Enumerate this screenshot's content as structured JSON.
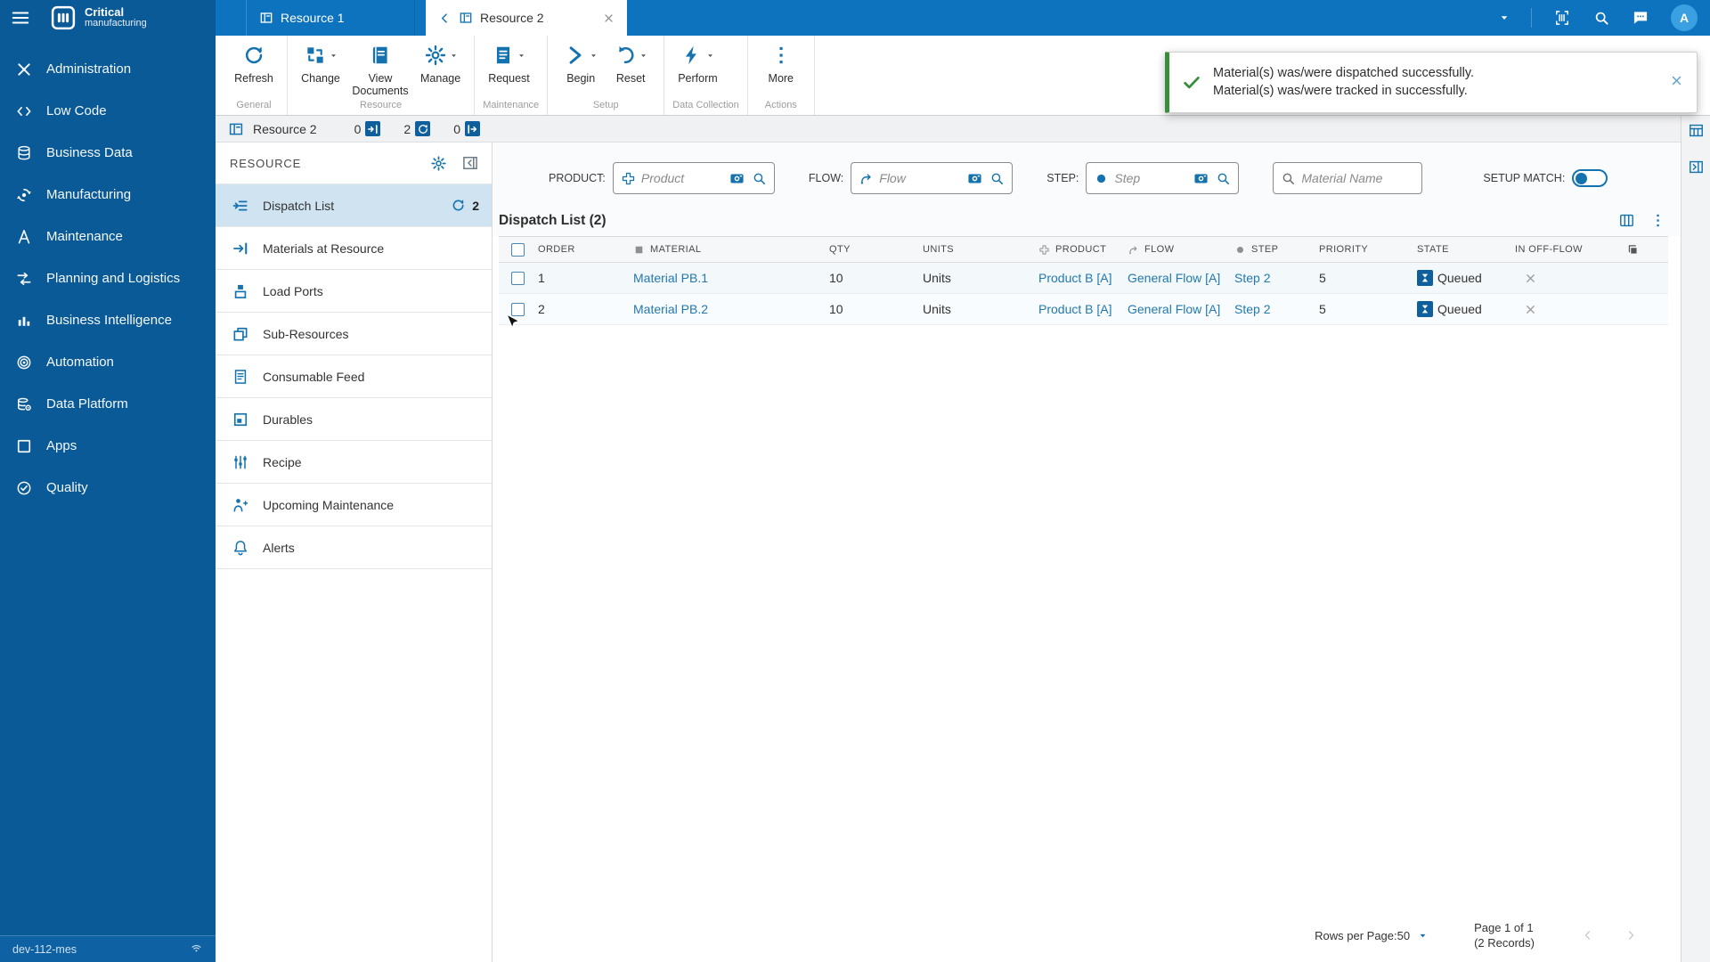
{
  "colors": {
    "sidebar": "#0a5a97",
    "topbar": "#0d73be",
    "accent": "#1473af",
    "link": "#2279ae",
    "toast_green": "#388e3c",
    "selected_item": "#cfe3f1"
  },
  "sidebar": {
    "brand": {
      "line1": "Critical",
      "line2": "manufacturing"
    },
    "items": [
      {
        "label": "Administration",
        "icon": "administration-icon"
      },
      {
        "label": "Low Code",
        "icon": "low-code-icon"
      },
      {
        "label": "Business Data",
        "icon": "business-data-icon"
      },
      {
        "label": "Manufacturing",
        "icon": "manufacturing-icon"
      },
      {
        "label": "Maintenance",
        "icon": "maintenance-icon"
      },
      {
        "label": "Planning and Logistics",
        "icon": "planning-logistics-icon"
      },
      {
        "label": "Business Intelligence",
        "icon": "business-intelligence-icon"
      },
      {
        "label": "Automation",
        "icon": "automation-icon"
      },
      {
        "label": "Data Platform",
        "icon": "data-platform-icon"
      },
      {
        "label": "Apps",
        "icon": "apps-icon"
      },
      {
        "label": "Quality",
        "icon": "quality-icon"
      }
    ],
    "footer": {
      "environment": "dev-112-mes"
    }
  },
  "header": {
    "tabs": [
      {
        "label": "Resource 1",
        "active": false
      },
      {
        "label": "Resource 2",
        "active": true
      }
    ],
    "avatar_initial": "A"
  },
  "toolbar": {
    "groups": [
      {
        "label": "General",
        "buttons": [
          {
            "label": "Refresh",
            "icon": "refresh-icon",
            "dropdown": false
          }
        ]
      },
      {
        "label": "Resource",
        "buttons": [
          {
            "label": "Change",
            "icon": "change-icon",
            "dropdown": true
          },
          {
            "label": "View Documents",
            "icon": "view-documents-icon",
            "dropdown": false
          },
          {
            "label": "Manage",
            "icon": "manage-icon",
            "dropdown": true
          }
        ]
      },
      {
        "label": "Maintenance",
        "buttons": [
          {
            "label": "Request",
            "icon": "request-icon",
            "dropdown": true
          }
        ]
      },
      {
        "label": "Setup",
        "buttons": [
          {
            "label": "Begin",
            "icon": "begin-icon",
            "dropdown": true
          },
          {
            "label": "Reset",
            "icon": "reset-icon",
            "dropdown": true
          }
        ]
      },
      {
        "label": "Data Collection",
        "buttons": [
          {
            "label": "Perform",
            "icon": "perform-icon",
            "dropdown": true
          }
        ]
      },
      {
        "label": "Actions",
        "buttons": [
          {
            "label": "More",
            "icon": "more-icon",
            "dropdown": false
          }
        ]
      }
    ]
  },
  "breadcrumb": {
    "title": "Resource 2",
    "counters": [
      {
        "value": "0",
        "icon": "track-in-icon"
      },
      {
        "value": "2",
        "icon": "queue-count-icon"
      },
      {
        "value": "0",
        "icon": "track-out-icon"
      }
    ]
  },
  "resource_panel": {
    "title": "RESOURCE",
    "items": [
      {
        "label": "Dispatch List",
        "icon": "dispatch-list-icon",
        "selected": true,
        "badge": "2"
      },
      {
        "label": "Materials at Resource",
        "icon": "materials-at-resource-icon",
        "selected": false
      },
      {
        "label": "Load Ports",
        "icon": "load-ports-icon",
        "selected": false
      },
      {
        "label": "Sub-Resources",
        "icon": "sub-resources-icon",
        "selected": false
      },
      {
        "label": "Consumable Feed",
        "icon": "consumable-feed-icon",
        "selected": false
      },
      {
        "label": "Durables",
        "icon": "durables-icon",
        "selected": false
      },
      {
        "label": "Recipe",
        "icon": "recipe-icon",
        "selected": false
      },
      {
        "label": "Upcoming Maintenance",
        "icon": "upcoming-maintenance-icon",
        "selected": false
      },
      {
        "label": "Alerts",
        "icon": "alerts-icon",
        "selected": false
      }
    ]
  },
  "filters": {
    "product": {
      "label": "PRODUCT:",
      "placeholder": "Product"
    },
    "flow": {
      "label": "FLOW:",
      "placeholder": "Flow"
    },
    "step": {
      "label": "STEP:",
      "placeholder": "Step"
    },
    "material_name": {
      "placeholder": "Material Name"
    },
    "setup_match": {
      "label": "SETUP MATCH:",
      "enabled": false
    }
  },
  "dispatch": {
    "title": "Dispatch List (2)",
    "columns": [
      {
        "key": "select",
        "label": "",
        "icon": null
      },
      {
        "key": "order",
        "label": "ORDER",
        "icon": null
      },
      {
        "key": "material",
        "label": "MATERIAL",
        "icon": "material-square-icon"
      },
      {
        "key": "spacer",
        "label": "",
        "icon": null
      },
      {
        "key": "qty",
        "label": "QTY",
        "icon": null
      },
      {
        "key": "units",
        "label": "UNITS",
        "icon": null
      },
      {
        "key": "product",
        "label": "PRODUCT",
        "icon": "product-icon"
      },
      {
        "key": "flow",
        "label": "FLOW",
        "icon": "flow-icon"
      },
      {
        "key": "step",
        "label": "STEP",
        "icon": "step-icon"
      },
      {
        "key": "priority",
        "label": "PRIORITY",
        "icon": null
      },
      {
        "key": "state",
        "label": "STATE",
        "icon": null
      },
      {
        "key": "in_off_flow",
        "label": "IN OFF-FLOW",
        "icon": null
      },
      {
        "key": "copy",
        "label": "",
        "icon": "copy-icon"
      }
    ],
    "rows": [
      {
        "order": "1",
        "material": "Material PB.1",
        "qty": "10",
        "units": "Units",
        "product": "Product B [A]",
        "flow": "General Flow [A]",
        "step": "Step 2",
        "priority": "5",
        "state": "Queued"
      },
      {
        "order": "2",
        "material": "Material PB.2",
        "qty": "10",
        "units": "Units",
        "product": "Product B [A]",
        "flow": "General Flow [A]",
        "step": "Step 2",
        "priority": "5",
        "state": "Queued"
      }
    ]
  },
  "toast": {
    "line1": "Material(s) was/were dispatched successfully.",
    "line2": "Material(s) was/were tracked in successfully."
  },
  "pagination": {
    "rows_per_page": "Rows per Page:50",
    "page_label": "Page 1 of 1",
    "records_label": "(2 Records)"
  }
}
